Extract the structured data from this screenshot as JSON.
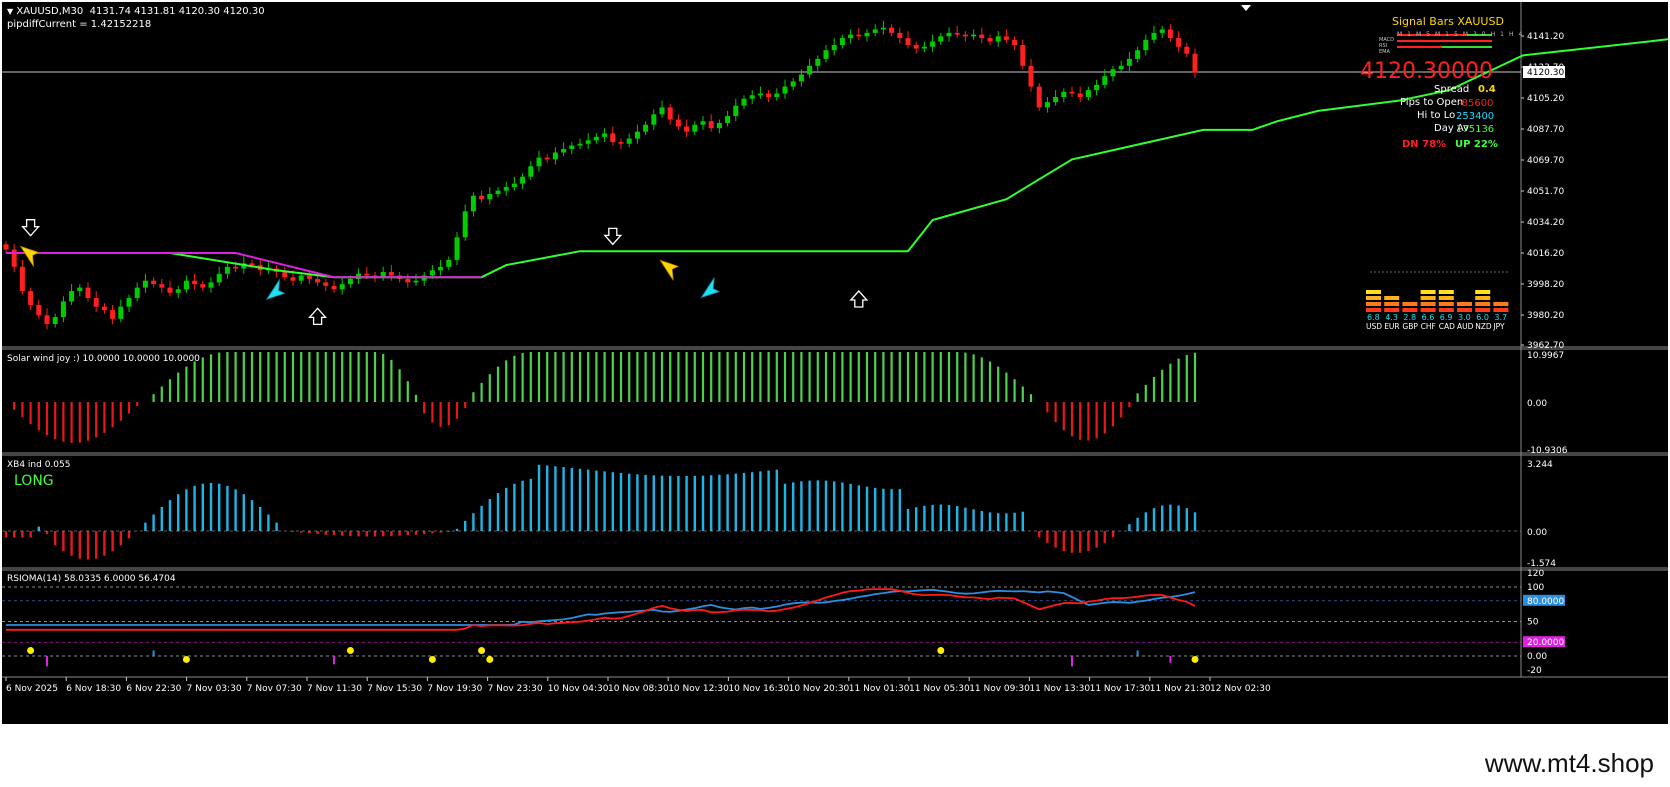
{
  "symbol": {
    "header": "XAUUSD,M30",
    "ohlc": "4131.74 4131.81 4120.30 4120.30",
    "pipdiff": "pipdiffCurrent = 1.42152218"
  },
  "main": {
    "price_axis": [
      "4141.20",
      "4123.70",
      "4105.20",
      "4087.70",
      "4069.70",
      "4051.70",
      "4034.20",
      "4016.20",
      "3998.20",
      "3980.20",
      "3962.70"
    ],
    "current_price_tag": "4120.30",
    "close_series": [
      4018,
      4008,
      3994,
      3986,
      3980,
      3975,
      3979,
      3988,
      3994,
      3996,
      3990,
      3985,
      3983,
      3978,
      3985,
      3990,
      3996,
      4000,
      3998,
      3996,
      3993,
      3995,
      4000,
      3998,
      3996,
      3999,
      4004,
      4008,
      4007,
      4010,
      4009,
      4006,
      4007,
      4005,
      4002,
      4000,
      4003,
      4001,
      3999,
      3997,
      3995,
      3998,
      4001,
      4004,
      4003,
      4002,
      4005,
      4003,
      4001,
      3999,
      4000,
      4003,
      4006,
      4008,
      4012,
      4025,
      4040,
      4049,
      4047,
      4050,
      4052,
      4054,
      4056,
      4060,
      4066,
      4071,
      4070,
      4074,
      4076,
      4078,
      4079,
      4081,
      4083,
      4085,
      4080,
      4079,
      4082,
      4086,
      4090,
      4096,
      4100,
      4093,
      4089,
      4086,
      4090,
      4092,
      4088,
      4091,
      4095,
      4101,
      4105,
      4107,
      4108,
      4106,
      4108,
      4112,
      4115,
      4119,
      4124,
      4128,
      4133,
      4136,
      4140,
      4142,
      4141,
      4143,
      4145,
      4146,
      4143,
      4140,
      4136,
      4134,
      4135,
      4138,
      4141,
      4143,
      4142,
      4141,
      4142,
      4140,
      4138,
      4141,
      4139,
      4136,
      4124,
      4112,
      4100,
      4103,
      4106,
      4109,
      4108,
      4106,
      4110,
      4113,
      4118,
      4122,
      4124,
      4128,
      4133,
      4139,
      4143,
      4145,
      4140,
      4135,
      4131,
      4120
    ],
    "green_stop_line": [
      [
        3,
        4016
      ],
      [
        20,
        4016
      ],
      [
        33,
        4006
      ],
      [
        40,
        4002
      ],
      [
        58,
        4002
      ],
      [
        61,
        4009
      ],
      [
        70,
        4017
      ],
      [
        79,
        4017
      ],
      [
        99,
        4017
      ],
      [
        110,
        4017
      ],
      [
        113,
        4035
      ],
      [
        122,
        4047
      ],
      [
        130,
        4070
      ],
      [
        146,
        4087
      ],
      [
        152,
        4087
      ],
      [
        155,
        4092
      ],
      [
        160,
        4098
      ],
      [
        170,
        4104
      ],
      [
        176,
        4110
      ],
      [
        185,
        4130
      ],
      [
        204,
        4140
      ],
      [
        230,
        4140
      ],
      [
        237,
        4134
      ],
      [
        248,
        4125
      ],
      [
        266,
        4125
      ],
      [
        272,
        4135
      ],
      [
        280,
        4140
      ]
    ],
    "magenta_line": [
      [
        0,
        4016
      ],
      [
        28,
        4016
      ],
      [
        40,
        4002
      ],
      [
        50,
        4002
      ],
      [
        58,
        4002
      ]
    ],
    "magenta_line2": [
      [
        220,
        4140
      ],
      [
        230,
        4140
      ],
      [
        237,
        4133
      ],
      [
        245,
        4126
      ],
      [
        252,
        4125
      ]
    ],
    "arrows_down": [
      [
        3,
        4030
      ],
      [
        74,
        4025
      ],
      [
        232,
        4155
      ]
    ],
    "arrows_up": [
      [
        38,
        3980
      ],
      [
        104,
        3990
      ],
      [
        248,
        4113
      ]
    ],
    "yellow_arrows": [
      [
        3,
        4014
      ],
      [
        81,
        4006
      ],
      [
        240,
        4142
      ],
      [
        262,
        4133
      ]
    ],
    "cyan_arrows": [
      [
        33,
        3995
      ],
      [
        86,
        3996
      ],
      [
        252,
        4120
      ]
    ]
  },
  "signal_panel": {
    "title": "Signal Bars XAUUSD",
    "timeframes": [
      "M1",
      "M5",
      "M15",
      "M30",
      "H1",
      "H4"
    ],
    "rows": [
      "MACD",
      "RSI",
      "EMA"
    ],
    "big_price": "4120.30000",
    "spread_label": "Spread",
    "spread_value": "0.4",
    "pips_open_label": "Pips to Open",
    "pips_open_value": "-85600",
    "hi_lo_label": "Hi to Lo",
    "hi_lo_value": "253400",
    "day_label": "Day Av",
    "day_value": "175136",
    "dn_text": "DN 78%",
    "up_text": "UP 22%"
  },
  "currency_strength": {
    "currencies": [
      "USD",
      "EUR",
      "GBP",
      "CHF",
      "CAD",
      "AUD",
      "NZD",
      "JPY"
    ],
    "values": [
      "6.8",
      "4.3",
      "2.8",
      "6.6",
      "6.9",
      "3.0",
      "6.0",
      "3.7"
    ],
    "levels": [
      6.8,
      4.3,
      2.8,
      6.6,
      6.9,
      3.0,
      6.0,
      3.7
    ]
  },
  "solar": {
    "label": "Solar wind joy :) 10.0000 10.0000 10.0000",
    "axis": [
      "10.9967",
      "0.00",
      "-10.9306"
    ]
  },
  "xb4": {
    "label": "XB4 ind 0.055",
    "signal": "LONG",
    "axis": [
      "3.244",
      "0.00",
      "-1.574"
    ]
  },
  "rsioma": {
    "label": "RSIOMA(14) 58.0335 6.0000 56.4704",
    "axis": [
      "120",
      "100",
      "80.0000",
      "50",
      "20.0000",
      "0.00",
      "-20"
    ]
  },
  "time_axis": [
    "6 Nov 2025",
    "6 Nov 18:30",
    "6 Nov 22:30",
    "7 Nov 03:30",
    "7 Nov 07:30",
    "7 Nov 11:30",
    "7 Nov 15:30",
    "7 Nov 19:30",
    "7 Nov 23:30",
    "10 Nov 04:30",
    "10 Nov 08:30",
    "10 Nov 12:30",
    "10 Nov 16:30",
    "10 Nov 20:30",
    "11 Nov 01:30",
    "11 Nov 05:30",
    "11 Nov 09:30",
    "11 Nov 13:30",
    "11 Nov 17:30",
    "11 Nov 21:30",
    "12 Nov 02:30"
  ],
  "colors": {
    "bull": "#00cc00",
    "bear": "#ff2020",
    "stop_line": "#32ff32",
    "magenta": "#e020e0",
    "hist_blue": "#1eb4e6",
    "rsi_red": "#ff1a1a",
    "rsi_blue": "#2b8fe0",
    "accent_yellow": "#ffd700"
  },
  "watermark": "www.mt4.shop"
}
